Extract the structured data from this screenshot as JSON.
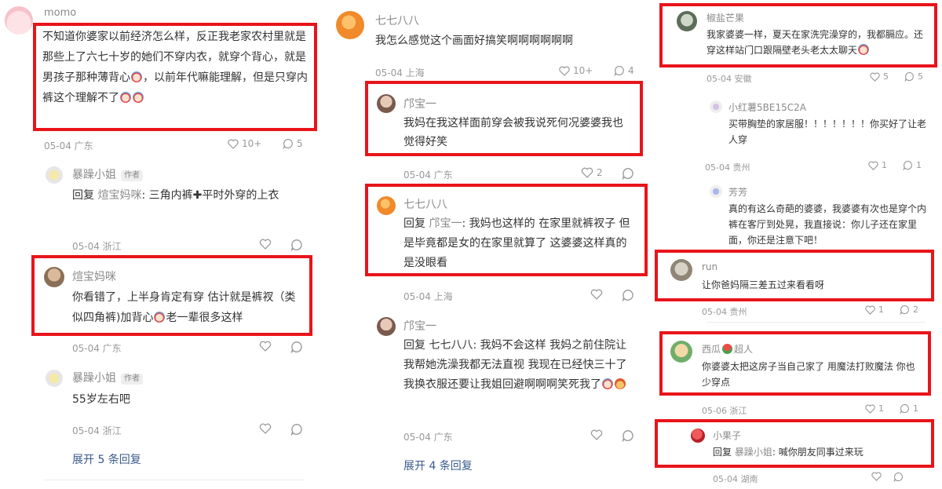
{
  "col1": {
    "c1": {
      "user": "momo",
      "text_a": "不知道你婆家以前经济怎么样，反正我老家农村里就是那些上了六七十岁的她们不穿内衣，就穿个背心，就是男孩子那种薄背心",
      "text_b": "，以前年代嘛能理解，但是只穿内裤这个理解不了",
      "meta": "05-04  广东",
      "likes": "10+",
      "comments": "5"
    },
    "r1": {
      "user": "暴躁小姐",
      "badge": "作者",
      "text_a": "回复 ",
      "mention": "煊宝妈咪",
      "text_b": ": 三角内裤",
      "text_c": "平时外穿的上衣",
      "meta": "05-04  浙江"
    },
    "r2": {
      "user": "煊宝妈咪",
      "text_a": "你看错了，上半身肯定有穿 估计就是裤衩（类似四角裤)加背心",
      "text_b": "老一辈很多这样",
      "meta": "05-04  广东"
    },
    "r3": {
      "user": "暴躁小姐",
      "badge": "作者",
      "text": "55岁左右吧",
      "meta": "05-04  浙江"
    },
    "expand": "展开 5 条回复"
  },
  "col2": {
    "c1": {
      "user": "七七八八",
      "text": "我怎么感觉这个画面好搞笑啊啊啊啊啊啊",
      "meta": "05-04  上海",
      "likes": "10+",
      "comments": "4"
    },
    "r1": {
      "user": "邝宝一",
      "text": "我妈在我这样面前穿会被我说死何况婆婆我也觉得好笑",
      "meta": "05-04  广东",
      "likes": "2"
    },
    "r2": {
      "user": "七七八八",
      "text_a": "回复 ",
      "mention": "邝宝一",
      "text_b": ": 我妈也这样的 在家里就裤衩子 但是毕竟都是女的在家里就算了 这婆婆这样真的是没眼看",
      "meta": "05-04  上海"
    },
    "r3": {
      "user": "邝宝一",
      "text_a": "回复 七七八八: 我妈不会这样 我妈之前住院让我帮她洗澡我都无法直视 我现在已经快三十了 我换衣服还要让我姐回避啊啊啊笑死我了",
      "meta": "05-04  广东"
    },
    "expand": "展开 4 条回复"
  },
  "col3": {
    "c1": {
      "user": "椒盐芒果",
      "text": "我家婆婆一样，夏天在家洗完澡穿的，我都膈应。还穿这样站门口跟隔壁老头老太太聊天",
      "meta": "05-04  安徽",
      "likes": "5",
      "comments": "5"
    },
    "r1": {
      "user": "小红薯5BE15C2A",
      "text": "买带胸垫的家居服！！！！！！！你买好了让老人穿",
      "meta": "05-04  贵州",
      "likes": "1",
      "comments": "1"
    },
    "r2": {
      "user": "芳芳",
      "text": "真的有这么奇葩的婆婆，我婆婆有次也是穿个内裤在客厅到处晃，我直接说：你儿子还在家里面，你还是注意下吧！"
    },
    "c2": {
      "user": "run",
      "text": "让你爸妈隔三差五过来看看呀",
      "meta": "05-04  贵州",
      "likes": "1",
      "comments": "2"
    },
    "c3": {
      "user_a": "西瓜",
      "user_b": "超人",
      "text": "你婆婆太把这房子当自己家了 用魔法打败魔法 你也少穿点",
      "meta": "05-06  浙江",
      "likes": "1",
      "comments": "1"
    },
    "c4": {
      "user": "小果子",
      "text_a": "回复 ",
      "mention": "暴躁小姐",
      "text_b": ": 喊你朋友同事过来玩",
      "meta": "05-04  湖南"
    }
  }
}
